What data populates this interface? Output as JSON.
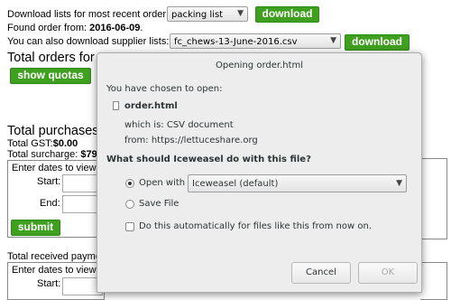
{
  "form": {
    "download_recent_label": "Download lists for most recent order:",
    "list_type_value": "packing list",
    "download_label": "download",
    "found_order_prefix": "Found order from: ",
    "found_order_date": "2016-06-09",
    "found_order_suffix": ".",
    "supplier_lists_label": "You can also download supplier lists:",
    "supplier_list_value": "fc_chews-13-June-2016.csv",
    "download2_label": "download"
  },
  "orders": {
    "heading": "Total orders for",
    "show_quotas_label": "show quotas"
  },
  "purchases": {
    "heading": "Total purchases",
    "gst_label": "Total GST:",
    "gst_value": "$0.00",
    "surcharge_label": "Total surcharge:",
    "surcharge_value": "$79.",
    "box_label": "Enter dates to view p",
    "start_label": "Start:",
    "end_label": "End:",
    "submit_label": "submit"
  },
  "received": {
    "heading": "Total received payme",
    "box_label": "Enter dates to view r",
    "start_label": "Start:"
  },
  "dialog": {
    "title": "Opening order.html",
    "chosen_label": "You have chosen to open:",
    "file_name": "order.html",
    "file_icon": "document-icon",
    "which_is": "which is:  CSV document",
    "from": "from:  https://lettuceshare.org",
    "question": "What should Iceweasel do with this file?",
    "open_with_label": "Open with",
    "open_with_value": "Iceweasel (default)",
    "save_file_label": "Save File",
    "auto_label": "Do this automatically for files like this from now on.",
    "cancel_label": "Cancel",
    "ok_label": "OK"
  }
}
